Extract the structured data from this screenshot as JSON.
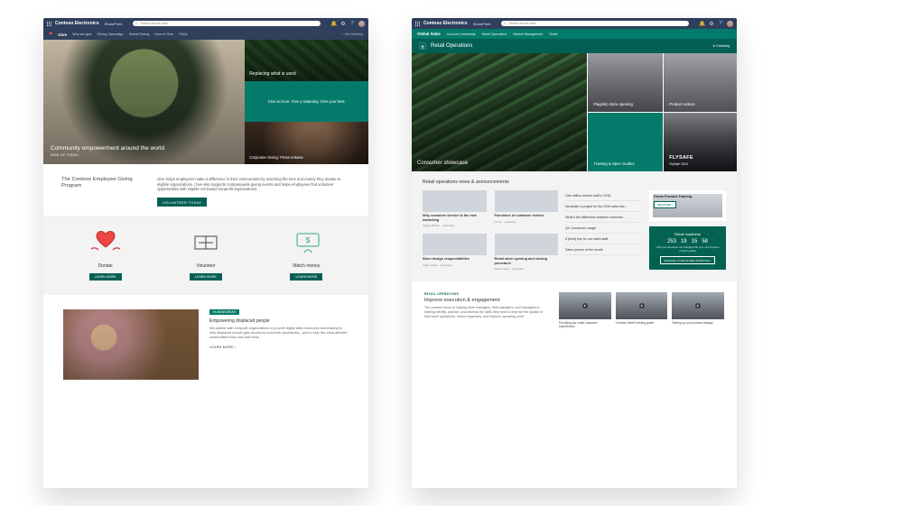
{
  "suite": {
    "org": "Contoso Electronics",
    "app": "SharePoint",
    "search_placeholder": "Search across sites"
  },
  "pageA": {
    "nav": {
      "brand": "Give",
      "items": [
        "Why we give",
        "Giving Campaign",
        "Global Giving",
        "How to Give",
        "FAQs"
      ],
      "follow": "Not following"
    },
    "hero": {
      "main": {
        "title": "Community empowerment around the world",
        "cta": "SIGN UP TODAY ›"
      },
      "r1": {
        "title": "Replacing what is used"
      },
      "r2": {
        "text": "Give an hour. Give a Saturday. Give your best."
      },
      "r3": {
        "title": "Corporate Giving: Press release"
      }
    },
    "intro": {
      "heading": "The Contoso Employee Giving Program",
      "body": "Give helps employees make a difference in their communities by matching the time and money they donate to eligible organizations. Give also supports companywide giving events and helps employees find volunteer opportunities with eligible US-based nonprofit organizations.",
      "button": "VOLUNTEER TODAY"
    },
    "cols": [
      {
        "title": "Donate",
        "button": "LEARN MORE"
      },
      {
        "title": "Volunteer",
        "button": "LEARN MORE"
      },
      {
        "title": "Match money",
        "button": "LEARN MORE"
      }
    ],
    "disp": {
      "tag": "HUMANITARIAN",
      "title": "Empowering displaced people",
      "body": "We partner with nonprofit organizations to provide digital skills resources and training to help displaced people gain access to economic opportunity—and to help the crisis-affected communities they now call home.",
      "more": "LEARN MORE ›"
    }
  },
  "pageB": {
    "nav": {
      "brand": "Global Sales",
      "items": [
        "Account Leadership",
        "Retail Operations",
        "Market Management",
        "Retail"
      ]
    },
    "header": {
      "title": "Retail Operations",
      "follow": "Following"
    },
    "hero": {
      "main": "Consumer showcase",
      "t1": "Flagship store opening",
      "t2": "Product videos",
      "t3": "Training & Spec Guides",
      "t4": "FLYSAFE",
      "t4sub": "FlySafe 2019"
    },
    "news": {
      "heading": "Retail operations news & announcements",
      "cards": [
        {
          "title": "Why customer service is the new marketing",
          "meta": "Megan Bowen · yesterday"
        },
        {
          "title": "Functions of customer service",
          "meta": "Ian Xu · yesterday"
        },
        {
          "title": "Store design responsibilities",
          "meta": "Adele Vance · yesterday"
        },
        {
          "title": "Retail store opening and closing procedure",
          "meta": "Adele Vance · yesterday"
        }
      ],
      "links": [
        "One million drones sold in 2018",
        "Nominate a project for the 2019 sales lea…",
        "What's the difference between customer…",
        "Q4: Consumer usage",
        "5 (best) tips for our sales staff",
        "Sales person of the month"
      ],
      "promo": {
        "title": "Drone Product Training",
        "button": "REGISTER ›"
      },
      "countdown": {
        "title": "Retail readiness",
        "nums": [
          "253",
          "19",
          "15",
          "58"
        ],
        "units": [
          "days",
          "hrs",
          "min",
          "sec"
        ],
        "sub": "Until your doorsteps are indulged with your new Contoso product guides",
        "button": "MANAGE YOUR STORE INVENTORY"
      }
    },
    "train": {
      "eyebrow": "RETAIL OPERATIONS",
      "heading": "Improve execution & engagement",
      "body": "The courses focus on helping store managers, field managers, and managers-in-training identify, practice, and develop the skills they need to improve the quality of their store operations, reduce expenses, and improve operating profit.",
      "videos": [
        "Providing top notch customer experiences",
        "Contoso MaxR training guide",
        "Setting up your product display"
      ]
    }
  }
}
